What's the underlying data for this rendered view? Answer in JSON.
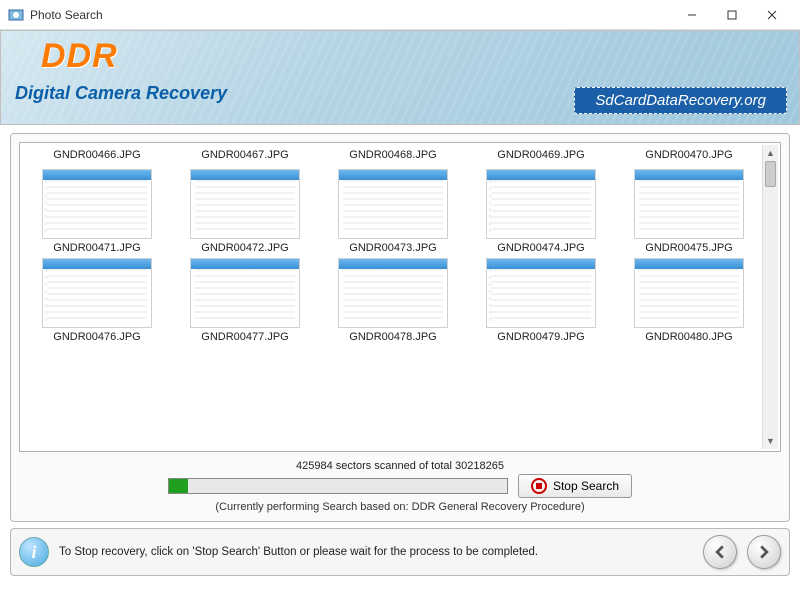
{
  "window": {
    "title": "Photo Search"
  },
  "banner": {
    "logo": "DDR",
    "subtitle": "Digital Camera Recovery",
    "ribbon": "SdCardDataRecovery.org"
  },
  "files": {
    "row1_labels": [
      "GNDR00466.JPG",
      "GNDR00467.JPG",
      "GNDR00468.JPG",
      "GNDR00469.JPG",
      "GNDR00470.JPG"
    ],
    "row2_labels": [
      "GNDR00471.JPG",
      "GNDR00472.JPG",
      "GNDR00473.JPG",
      "GNDR00474.JPG",
      "GNDR00475.JPG"
    ],
    "row3_labels": [
      "GNDR00476.JPG",
      "GNDR00477.JPG",
      "GNDR00478.JPG",
      "GNDR00479.JPG",
      "GNDR00480.JPG"
    ]
  },
  "progress": {
    "status_line": "425984 sectors scanned of total 30218265",
    "percent": 1.4,
    "basis_line": "(Currently performing Search based on:  DDR General Recovery Procedure)",
    "stop_label": "Stop Search"
  },
  "footer": {
    "message": "To Stop recovery, click on 'Stop Search' Button or please wait for the process to be completed."
  }
}
